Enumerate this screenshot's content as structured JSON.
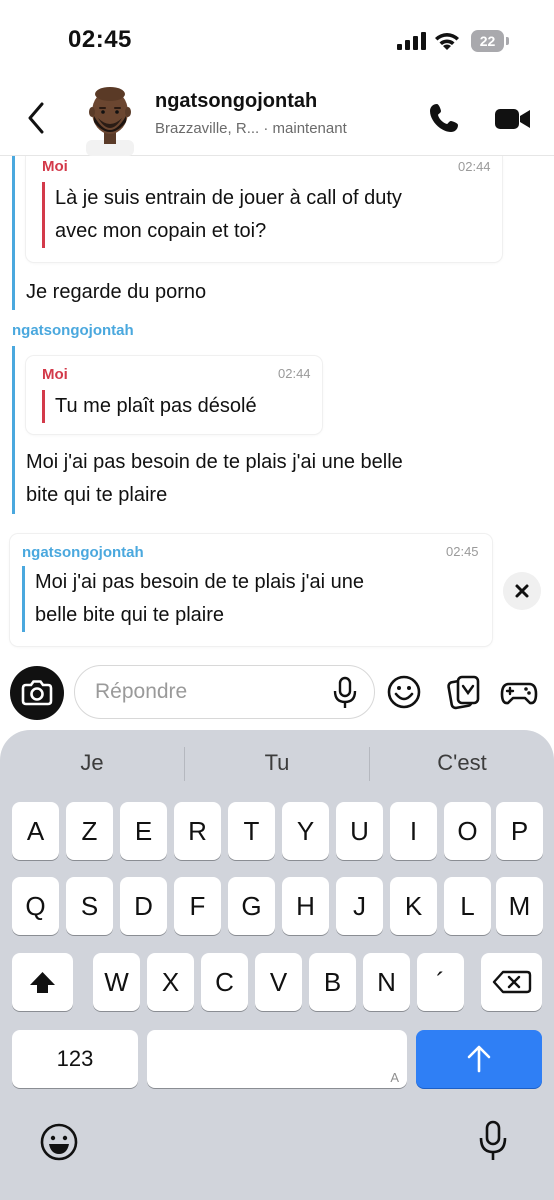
{
  "status_bar": {
    "time": "02:45",
    "battery": "22"
  },
  "header": {
    "contact_name": "ngatsongojontah",
    "subtitle": "Brazzaville, R... · maintenant"
  },
  "messages": {
    "block1": {
      "quote": {
        "sender": "Moi",
        "time": "02:44",
        "lines": [
          "Là je suis entrain de jouer à call of duty",
          "avec mon copain et toi?"
        ]
      },
      "text": "Je regarde du porno"
    },
    "block2": {
      "sender": "ngatsongojontah",
      "quote": {
        "sender": "Moi",
        "time": "02:44",
        "lines": [
          "Tu me plaît pas désolé"
        ]
      },
      "lines": [
        "Moi j'ai pas besoin de te plais j'ai une belle",
        "bite qui te plaire"
      ]
    },
    "reply_preview": {
      "sender": "ngatsongojontah",
      "time": "02:45",
      "lines": [
        "Moi j'ai pas besoin de te plais j'ai une",
        "belle bite qui te plaire"
      ]
    }
  },
  "composer": {
    "placeholder": "Répondre"
  },
  "keyboard": {
    "suggestions": [
      "Je",
      "Tu",
      "C'est"
    ],
    "row1": [
      "A",
      "Z",
      "E",
      "R",
      "T",
      "Y",
      "U",
      "I",
      "O",
      "P"
    ],
    "row2": [
      "Q",
      "S",
      "D",
      "F",
      "G",
      "H",
      "J",
      "K",
      "L",
      "M"
    ],
    "row3": [
      "W",
      "X",
      "C",
      "V",
      "B",
      "N",
      "´"
    ],
    "numbers_label": "123",
    "space_hint": "A"
  },
  "colors": {
    "accent_blue": "#4aa8de",
    "me_red": "#d33a4a",
    "return_key": "#2f7ff5"
  }
}
